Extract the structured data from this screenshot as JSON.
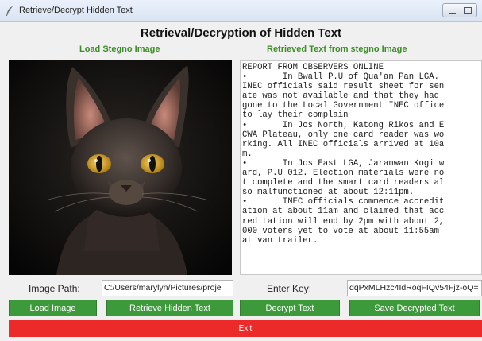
{
  "window": {
    "title": "Retrieve/Decrypt Hidden Text"
  },
  "header": {
    "title": "Retrieval/Decryption of Hidden Text",
    "left_subtitle": "Load Stegno Image",
    "right_subtitle": "Retrieved Text from stegno Image"
  },
  "image_panel": {
    "subject": "cat-photo"
  },
  "text_panel": {
    "lines": [
      "REPORT FROM OBSERVERS ONLINE",
      "•       In Bwall P.U of Qua'an Pan LGA.",
      "INEC officials said result sheet for sen",
      "ate was not available and that they had",
      "gone to the Local Government INEC office",
      "to lay their complain",
      "•       In Jos North, Katong Rikos and E",
      "CWA Plateau, only one card reader was wo",
      "rking. All INEC officials arrived at 10a",
      "m.",
      "•       In Jos East LGA, Jaranwan Kogi w",
      "ard, P.U 012. Election materials were no",
      "t complete and the smart card readers al",
      "so malfunctioned at about 12:11pm.",
      "•       INEC officials commence accredit",
      "ation at about 11am and claimed that acc",
      "reditation will end by 2pm with about 2,",
      "000 voters yet to vote at about 11:55am",
      "at van trailer."
    ]
  },
  "form": {
    "image_path_label": "Image Path:",
    "image_path_value": "C:/Users/marylyn/Pictures/proje",
    "key_label": "Enter Key:",
    "key_value": "dqPxMLHzc4IdRoqFIQv54Fjz-oQ="
  },
  "buttons": {
    "load_image": "Load Image",
    "retrieve_hidden_text": "Retrieve Hidden Text",
    "decrypt_text": "Decrypt Text",
    "save_decrypted_text": "Save Decrypted Text",
    "exit": "Exit"
  },
  "colors": {
    "subtitle_green": "#3b8e26",
    "button_green": "#3d9a3a",
    "exit_red": "#ec2a2a"
  }
}
